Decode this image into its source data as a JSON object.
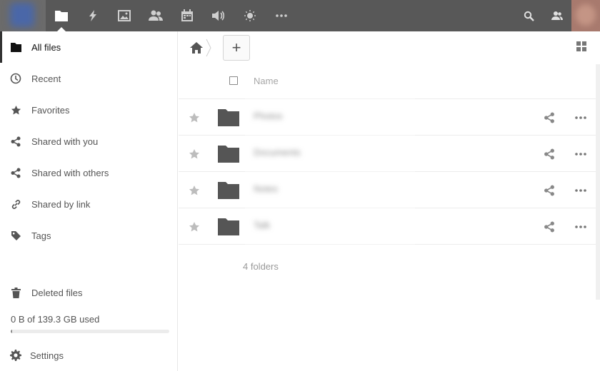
{
  "header": {
    "apps": [
      {
        "name": "files",
        "icon": "folder-icon",
        "active": true
      },
      {
        "name": "activity",
        "icon": "lightning-icon",
        "active": false
      },
      {
        "name": "gallery",
        "icon": "image-icon",
        "active": false
      },
      {
        "name": "contacts",
        "icon": "contacts-icon",
        "active": false
      },
      {
        "name": "calendar",
        "icon": "calendar-icon",
        "active": false
      },
      {
        "name": "announcements",
        "icon": "megaphone-icon",
        "active": false
      },
      {
        "name": "weather",
        "icon": "sun-icon",
        "active": false
      },
      {
        "name": "more-apps",
        "icon": "more-icon",
        "active": false
      }
    ],
    "search_icon": "search-icon",
    "contacts_menu_icon": "contacts-menu-icon"
  },
  "sidebar": {
    "items": [
      {
        "label": "All files",
        "icon": "folder-icon"
      },
      {
        "label": "Recent",
        "icon": "clock-icon"
      },
      {
        "label": "Favorites",
        "icon": "star-icon"
      },
      {
        "label": "Shared with you",
        "icon": "share-icon"
      },
      {
        "label": "Shared with others",
        "icon": "share-icon"
      },
      {
        "label": "Shared by link",
        "icon": "link-icon"
      },
      {
        "label": "Tags",
        "icon": "tag-icon"
      }
    ],
    "deleted": {
      "label": "Deleted files",
      "icon": "trash-icon"
    },
    "quota": {
      "text": "0 B of 139.3 GB used",
      "fraction": 0.003
    },
    "settings": {
      "label": "Settings",
      "icon": "gear-icon"
    }
  },
  "controls": {
    "new_label": "+"
  },
  "list": {
    "name_header": "Name",
    "rows": [
      {
        "name": "Photos"
      },
      {
        "name": "Documents"
      },
      {
        "name": "Notes"
      },
      {
        "name": "Talk"
      }
    ],
    "summary": "4 folders"
  },
  "colors": {
    "header_bg": "#585858",
    "text_muted": "#555555",
    "icon_dark": "#555555"
  }
}
